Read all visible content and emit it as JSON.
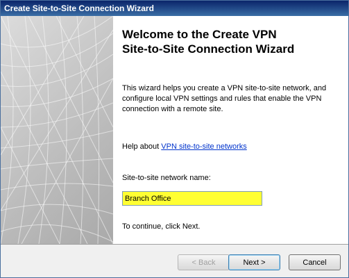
{
  "window": {
    "title": "Create Site-to-Site Connection Wizard"
  },
  "welcome": {
    "heading_line1": "Welcome to the Create VPN",
    "heading_line2": "Site-to-Site Connection Wizard",
    "description": "This wizard helps you create a VPN site-to-site network, and configure local VPN settings and rules that enable the VPN connection with a remote site.",
    "help_prefix": "Help about ",
    "help_link": "VPN site-to-site networks",
    "network_name_label": "Site-to-site network name:",
    "network_name_value": "Branch Office",
    "continue_text": "To continue, click Next."
  },
  "buttons": {
    "back": "< Back",
    "next": "Next >",
    "cancel": "Cancel"
  },
  "colors": {
    "title_bar": "#0a246a",
    "input_highlight": "#ffff33",
    "link": "#0033cc"
  }
}
